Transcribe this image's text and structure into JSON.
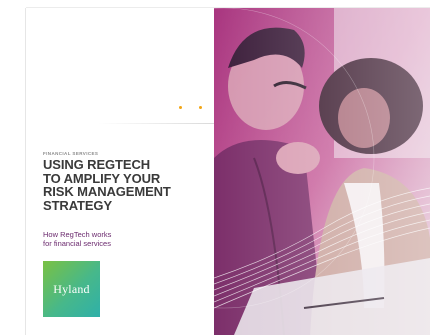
{
  "cover": {
    "category": "FINANCIAL SERVICES",
    "title_lines": [
      "USING REGTECH",
      "TO AMPLIFY YOUR",
      "RISK MANAGEMENT",
      "STRATEGY"
    ],
    "subtitle_lines": [
      "How RegTech works",
      "for financial services"
    ],
    "logo_text": "Hyland"
  },
  "colors": {
    "title": "#3a3a3a",
    "subtitle": "#6b2a6e",
    "accent_dots": "#f2a516",
    "logo_green": "#7ac143",
    "logo_teal": "#2fb0a9",
    "photo_magenta": "#b23c8e"
  },
  "photo": {
    "description_icon": "photo-two-people-meeting"
  }
}
